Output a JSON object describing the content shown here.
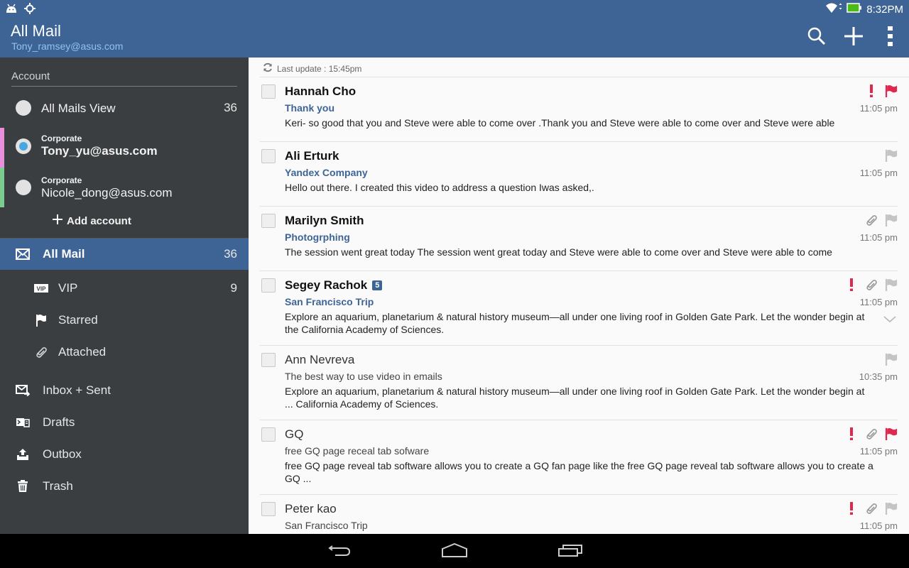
{
  "status_bar": {
    "time": "8:32PM"
  },
  "header": {
    "title": "All Mail",
    "account_email": "Tony_ramsey@asus.com"
  },
  "sidebar": {
    "section_label": "Account",
    "accounts": [
      {
        "type": "",
        "label": "All Mails View",
        "count": "36",
        "selected": false,
        "strip_color": ""
      },
      {
        "type": "Corporate",
        "label": "Tony_yu@asus.com",
        "count": "",
        "selected": true,
        "strip_color": "#e88fdc"
      },
      {
        "type": "Corporate",
        "label": "Nicole_dong@asus.com",
        "count": "",
        "selected": false,
        "strip_color": "#7dcc8f"
      }
    ],
    "add_account_label": "Add account",
    "folders": [
      {
        "label": "All Mail",
        "count": "36",
        "icon": "envelope-icon",
        "active": true
      },
      {
        "label": "VIP",
        "count": "9",
        "icon": "vip-icon",
        "active": false
      },
      {
        "label": "Starred",
        "count": "",
        "icon": "flag-icon",
        "active": false
      },
      {
        "label": "Attached",
        "count": "",
        "icon": "paperclip-icon",
        "active": false
      },
      {
        "label": "Inbox + Sent",
        "count": "",
        "icon": "inbox-sent-icon",
        "active": false
      },
      {
        "label": "Drafts",
        "count": "",
        "icon": "drafts-icon",
        "active": false
      },
      {
        "label": "Outbox",
        "count": "",
        "icon": "outbox-icon",
        "active": false
      },
      {
        "label": "Trash",
        "count": "",
        "icon": "trash-icon",
        "active": false
      }
    ]
  },
  "main": {
    "last_update": "Last update : 15:45pm",
    "emails": [
      {
        "sender": "Hannah Cho",
        "badge": "",
        "subject": "Thank you",
        "preview": "Keri- so good that you and Steve were able to come over .Thank you and Steve were able to come over and Steve were able",
        "time": "11:05 pm",
        "unread": true,
        "important": true,
        "attachment": false,
        "flagged": true
      },
      {
        "sender": "Ali Erturk",
        "badge": "",
        "subject": "Yandex Company",
        "preview": "Hello out there. I created this video to address a question Iwas asked,.",
        "time": "11:05 pm",
        "unread": true,
        "important": false,
        "attachment": false,
        "flagged": false
      },
      {
        "sender": "Marilyn Smith",
        "badge": "",
        "subject": "Photogrphing",
        "preview": "The session went great today The session went great today and Steve were able to come over and Steve were able to come",
        "time": "11:05 pm",
        "unread": true,
        "important": false,
        "attachment": true,
        "flagged": false
      },
      {
        "sender": "Segey Rachok",
        "badge": "5",
        "subject": "San Francisco Trip",
        "preview": "Explore an aquarium, planetarium & natural history museum—all under one living roof in Golden Gate Park. Let the wonder begin at the California Academy of Sciences.",
        "time": "11:05 pm",
        "unread": true,
        "important": true,
        "attachment": true,
        "flagged": false
      },
      {
        "sender": "Ann Nevreva",
        "badge": "",
        "subject": "The best way to use video in emails",
        "preview": "Explore an aquarium, planetarium & natural history museum—all under one living roof in Golden Gate Park. Let the wonder begin at ... California Academy of Sciences.",
        "time": "10:35 pm",
        "unread": false,
        "important": false,
        "attachment": false,
        "flagged": false
      },
      {
        "sender": "GQ",
        "badge": "",
        "subject": "free GQ page receal tab sofware",
        "preview": "free GQ page reveal tab software allows you to create a GQ fan page like the free GQ page reveal tab software allows you to create a GQ ...",
        "time": "11:05 pm",
        "unread": false,
        "important": true,
        "attachment": true,
        "flagged": true
      },
      {
        "sender": "Peter kao",
        "badge": "",
        "subject": "San Francisco Trip",
        "preview": "",
        "time": "11:05 pm",
        "unread": false,
        "important": true,
        "attachment": true,
        "flagged": false
      }
    ]
  },
  "colors": {
    "accent": "#3e6496",
    "alert": "#e0284f",
    "muted_icon": "#c4c4c4"
  }
}
